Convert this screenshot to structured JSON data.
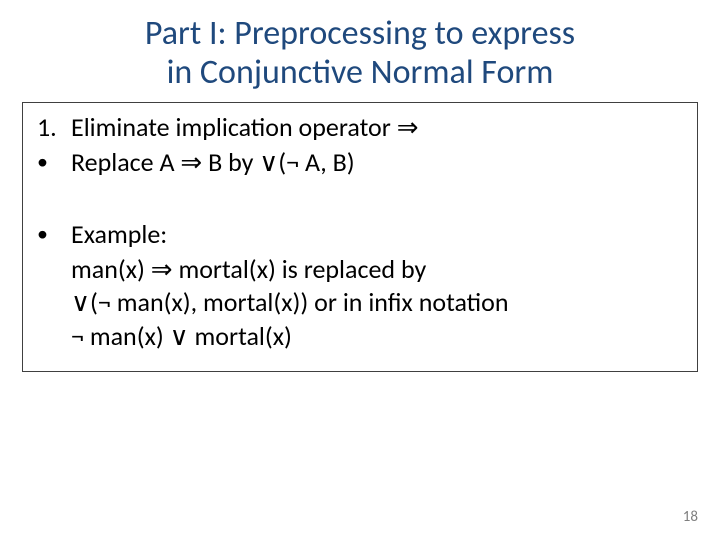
{
  "title_line1": "Part I: Preprocessing to express",
  "title_line2": "in Conjunctive Normal Form",
  "items": {
    "num1_marker": "1.",
    "num1_text": "Eliminate implication operator ⇒",
    "sub1_marker": "•",
    "sub1_text": "Replace  A ⇒ B by ∨(¬ A, B)",
    "sub2_marker": "•",
    "sub2_text": "Example:",
    "ex_line1": "man(x) ⇒ mortal(x) is replaced by",
    "ex_line2": "∨(¬ man(x), mortal(x)) or in infix notation",
    "ex_line3": "¬ man(x) ∨ mortal(x)"
  },
  "page_number": "18"
}
